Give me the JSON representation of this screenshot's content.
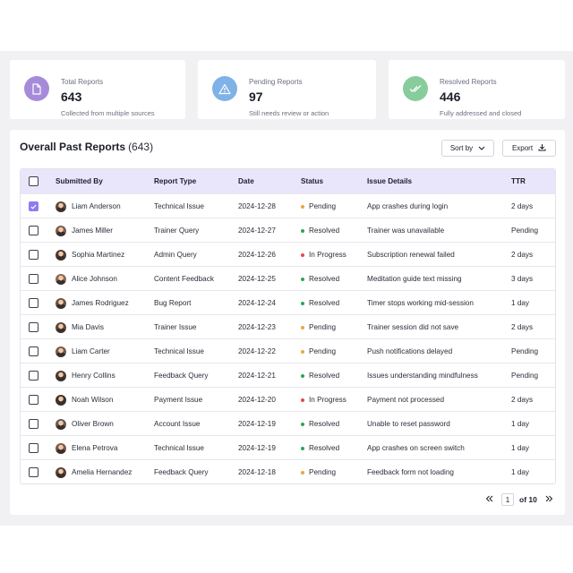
{
  "stats": [
    {
      "label": "Total Reports",
      "value": "643",
      "sub": "Collected from multiple sources",
      "icon": "document-icon",
      "color": "#a78bdb"
    },
    {
      "label": "Pending Reports",
      "value": "97",
      "sub": "Still needs review or action",
      "icon": "warning-icon",
      "color": "#7fb2e6"
    },
    {
      "label": "Resolved Reports",
      "value": "446",
      "sub": "Fully addressed and closed",
      "icon": "double-check-icon",
      "color": "#87cc9b"
    }
  ],
  "panel": {
    "title": "Overall Past Reports",
    "count": "(643)",
    "sort_label": "Sort by",
    "export_label": "Export"
  },
  "table": {
    "headers": [
      "Submitted By",
      "Report Type",
      "Date",
      "Status",
      "Issue Details",
      "TTR"
    ],
    "rows": [
      {
        "checked": true,
        "name": "Liam Anderson",
        "type": "Technical Issue",
        "date": "2024-12-28",
        "status": "Pending",
        "issue": "App crashes during login",
        "ttr": "2 days"
      },
      {
        "checked": false,
        "name": "James Miller",
        "type": "Trainer Query",
        "date": "2024-12-27",
        "status": "Resolved",
        "issue": "Trainer was unavailable",
        "ttr": "Pending"
      },
      {
        "checked": false,
        "name": "Sophia Martinez",
        "type": "Admin Query",
        "date": "2024-12-26",
        "status": "In Progress",
        "issue": "Subscription renewal failed",
        "ttr": "2 days"
      },
      {
        "checked": false,
        "name": "Alice Johnson",
        "type": "Content Feedback",
        "date": "2024-12-25",
        "status": "Resolved",
        "issue": "Meditation guide text missing",
        "ttr": "3 days"
      },
      {
        "checked": false,
        "name": "James Rodriguez",
        "type": "Bug Report",
        "date": "2024-12-24",
        "status": "Resolved",
        "issue": "Timer stops working mid-session",
        "ttr": "1 day"
      },
      {
        "checked": false,
        "name": "Mia Davis",
        "type": "Trainer Issue",
        "date": "2024-12-23",
        "status": "Pending",
        "issue": "Trainer session did not save",
        "ttr": "2 days"
      },
      {
        "checked": false,
        "name": "Liam Carter",
        "type": "Technical Issue",
        "date": "2024-12-22",
        "status": "Pending",
        "issue": "Push notifications delayed",
        "ttr": "Pending"
      },
      {
        "checked": false,
        "name": "Henry Collins",
        "type": "Feedback Query",
        "date": "2024-12-21",
        "status": "Resolved",
        "issue": "Issues understanding mindfulness",
        "ttr": "Pending"
      },
      {
        "checked": false,
        "name": "Noah Wilson",
        "type": "Payment Issue",
        "date": "2024-12-20",
        "status": "In Progress",
        "issue": "Payment not processed",
        "ttr": "2 days"
      },
      {
        "checked": false,
        "name": "Oliver Brown",
        "type": "Account Issue",
        "date": "2024-12-19",
        "status": "Resolved",
        "issue": "Unable to reset password",
        "ttr": "1 day"
      },
      {
        "checked": false,
        "name": "Elena Petrova",
        "type": "Technical Issue",
        "date": "2024-12-19",
        "status": "Resolved",
        "issue": "App crashes on screen switch",
        "ttr": "1 day"
      },
      {
        "checked": false,
        "name": "Amelia Hernandez",
        "type": "Feedback Query",
        "date": "2024-12-18",
        "status": "Pending",
        "issue": "Feedback form not loading",
        "ttr": "1 day"
      }
    ]
  },
  "status_colors": {
    "Pending": "#f2a33a",
    "Resolved": "#2fa35a",
    "In Progress": "#e5484d"
  },
  "pagination": {
    "current": "1",
    "of_label": "of 10"
  }
}
